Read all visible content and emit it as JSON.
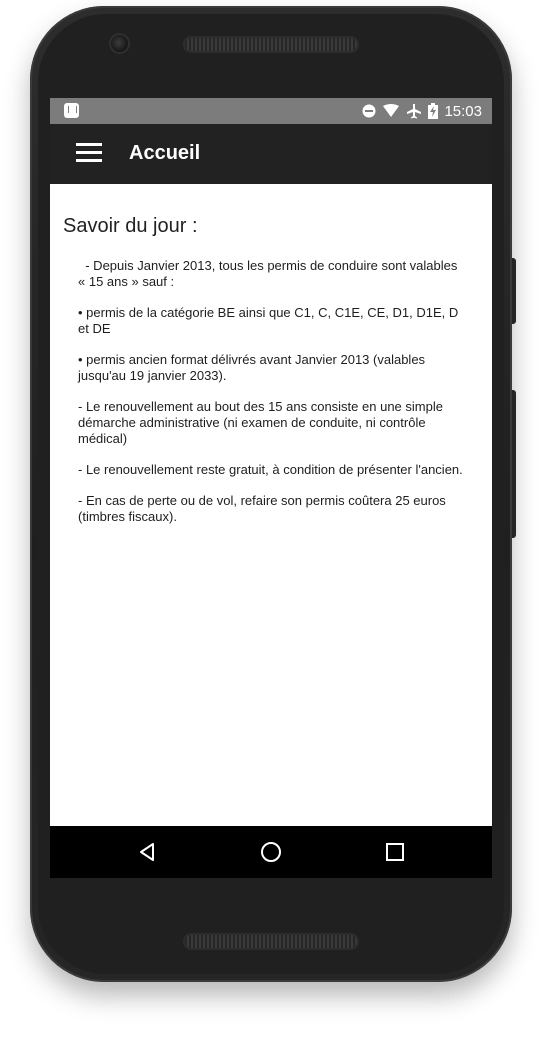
{
  "status_bar": {
    "time": "15:03",
    "icons": [
      "notification-icon",
      "do-not-disturb-icon",
      "wifi-icon",
      "airplane-mode-icon",
      "battery-charging-icon"
    ]
  },
  "app_bar": {
    "menu_icon": "hamburger-menu-icon",
    "title": "Accueil"
  },
  "content": {
    "title": "Savoir du jour :",
    "paragraphs": [
      "  - Depuis Janvier 2013, tous les permis de conduire sont valables « 15 ans » sauf :",
      "• permis de la catégorie BE ainsi que C1, C, C1E, CE, D1, D1E, D et DE",
      "• permis ancien format délivrés avant Janvier 2013 (valables jusqu'au 19 janvier 2033).",
      "- Le renouvellement au bout des 15 ans consiste en une simple démarche administrative (ni examen de conduite, ni contrôle médical)",
      "- Le renouvellement reste gratuit, à condition de présenter l'ancien.",
      "- En cas de perte ou de vol, refaire son permis coûtera 25 euros (timbres fiscaux)."
    ]
  },
  "nav_bar": {
    "buttons": [
      "back-triangle-icon",
      "home-circle-icon",
      "recents-square-icon"
    ]
  },
  "colors": {
    "status_bar": "#7c7c7c",
    "app_bar": "#222222",
    "nav_bar": "#000000",
    "phone_body": "#202020"
  }
}
